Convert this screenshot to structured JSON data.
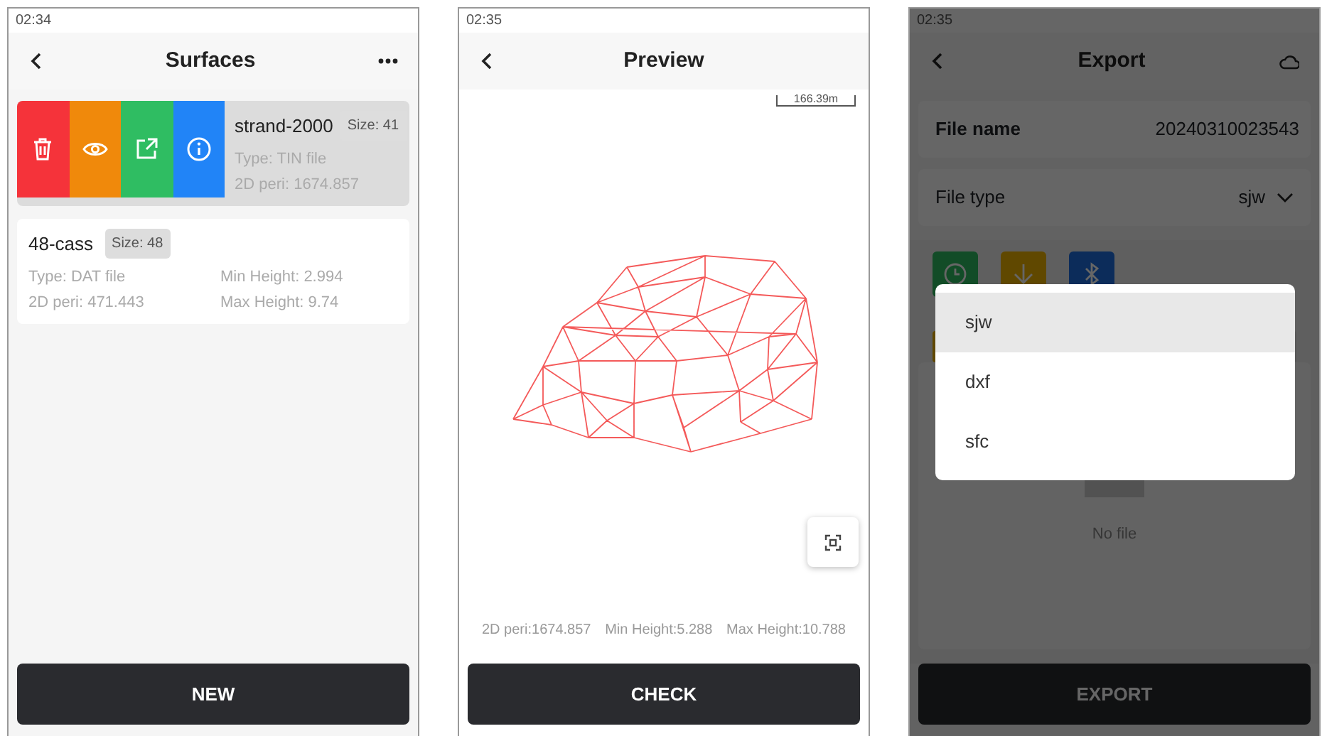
{
  "surfaces_screen": {
    "status_time": "02:34",
    "title": "Surfaces",
    "items": [
      {
        "name": "strand-2000",
        "size": "Size: 41",
        "type": "Type: TIN file",
        "peri": "2D peri: 1674.857",
        "swiped": true
      },
      {
        "name": "48-cass",
        "size": "Size: 48",
        "type": "Type: DAT file",
        "peri": "2D peri: 471.443",
        "min_height": "Min Height: 2.994",
        "max_height": "Max Height: 9.74",
        "swiped": false
      }
    ],
    "button": "NEW"
  },
  "preview_screen": {
    "status_time": "02:35",
    "title": "Preview",
    "scale": "166.39m",
    "stats": [
      "2D peri:1674.857",
      "Min Height:5.288",
      "Max Height:10.788"
    ],
    "button": "CHECK"
  },
  "export_screen": {
    "status_time": "02:35",
    "title": "Export",
    "file_name_label": "File name",
    "file_name": "20240310023543",
    "file_type_label": "File type",
    "file_type": "sjw",
    "options": [
      {
        "label": "sjw",
        "selected": true
      },
      {
        "label": "dxf",
        "selected": false
      },
      {
        "label": "sfc",
        "selected": false
      }
    ],
    "empty_text": "No file",
    "button": "EXPORT"
  }
}
